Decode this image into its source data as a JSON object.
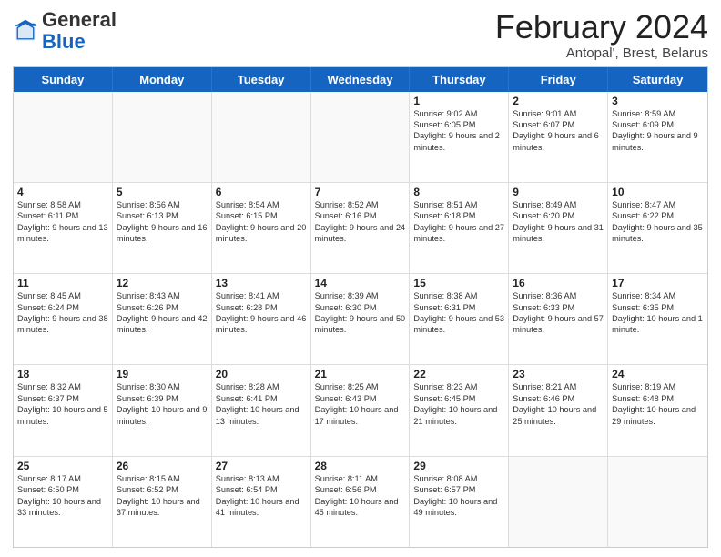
{
  "header": {
    "logo_general": "General",
    "logo_blue": "Blue",
    "month_title": "February 2024",
    "subtitle": "Antopal', Brest, Belarus"
  },
  "days_of_week": [
    "Sunday",
    "Monday",
    "Tuesday",
    "Wednesday",
    "Thursday",
    "Friday",
    "Saturday"
  ],
  "weeks": [
    [
      {
        "day": "",
        "content": ""
      },
      {
        "day": "",
        "content": ""
      },
      {
        "day": "",
        "content": ""
      },
      {
        "day": "",
        "content": ""
      },
      {
        "day": "1",
        "content": "Sunrise: 9:02 AM\nSunset: 6:05 PM\nDaylight: 9 hours\nand 2 minutes."
      },
      {
        "day": "2",
        "content": "Sunrise: 9:01 AM\nSunset: 6:07 PM\nDaylight: 9 hours\nand 6 minutes."
      },
      {
        "day": "3",
        "content": "Sunrise: 8:59 AM\nSunset: 6:09 PM\nDaylight: 9 hours\nand 9 minutes."
      }
    ],
    [
      {
        "day": "4",
        "content": "Sunrise: 8:58 AM\nSunset: 6:11 PM\nDaylight: 9 hours\nand 13 minutes."
      },
      {
        "day": "5",
        "content": "Sunrise: 8:56 AM\nSunset: 6:13 PM\nDaylight: 9 hours\nand 16 minutes."
      },
      {
        "day": "6",
        "content": "Sunrise: 8:54 AM\nSunset: 6:15 PM\nDaylight: 9 hours\nand 20 minutes."
      },
      {
        "day": "7",
        "content": "Sunrise: 8:52 AM\nSunset: 6:16 PM\nDaylight: 9 hours\nand 24 minutes."
      },
      {
        "day": "8",
        "content": "Sunrise: 8:51 AM\nSunset: 6:18 PM\nDaylight: 9 hours\nand 27 minutes."
      },
      {
        "day": "9",
        "content": "Sunrise: 8:49 AM\nSunset: 6:20 PM\nDaylight: 9 hours\nand 31 minutes."
      },
      {
        "day": "10",
        "content": "Sunrise: 8:47 AM\nSunset: 6:22 PM\nDaylight: 9 hours\nand 35 minutes."
      }
    ],
    [
      {
        "day": "11",
        "content": "Sunrise: 8:45 AM\nSunset: 6:24 PM\nDaylight: 9 hours\nand 38 minutes."
      },
      {
        "day": "12",
        "content": "Sunrise: 8:43 AM\nSunset: 6:26 PM\nDaylight: 9 hours\nand 42 minutes."
      },
      {
        "day": "13",
        "content": "Sunrise: 8:41 AM\nSunset: 6:28 PM\nDaylight: 9 hours\nand 46 minutes."
      },
      {
        "day": "14",
        "content": "Sunrise: 8:39 AM\nSunset: 6:30 PM\nDaylight: 9 hours\nand 50 minutes."
      },
      {
        "day": "15",
        "content": "Sunrise: 8:38 AM\nSunset: 6:31 PM\nDaylight: 9 hours\nand 53 minutes."
      },
      {
        "day": "16",
        "content": "Sunrise: 8:36 AM\nSunset: 6:33 PM\nDaylight: 9 hours\nand 57 minutes."
      },
      {
        "day": "17",
        "content": "Sunrise: 8:34 AM\nSunset: 6:35 PM\nDaylight: 10 hours\nand 1 minute."
      }
    ],
    [
      {
        "day": "18",
        "content": "Sunrise: 8:32 AM\nSunset: 6:37 PM\nDaylight: 10 hours\nand 5 minutes."
      },
      {
        "day": "19",
        "content": "Sunrise: 8:30 AM\nSunset: 6:39 PM\nDaylight: 10 hours\nand 9 minutes."
      },
      {
        "day": "20",
        "content": "Sunrise: 8:28 AM\nSunset: 6:41 PM\nDaylight: 10 hours\nand 13 minutes."
      },
      {
        "day": "21",
        "content": "Sunrise: 8:25 AM\nSunset: 6:43 PM\nDaylight: 10 hours\nand 17 minutes."
      },
      {
        "day": "22",
        "content": "Sunrise: 8:23 AM\nSunset: 6:45 PM\nDaylight: 10 hours\nand 21 minutes."
      },
      {
        "day": "23",
        "content": "Sunrise: 8:21 AM\nSunset: 6:46 PM\nDaylight: 10 hours\nand 25 minutes."
      },
      {
        "day": "24",
        "content": "Sunrise: 8:19 AM\nSunset: 6:48 PM\nDaylight: 10 hours\nand 29 minutes."
      }
    ],
    [
      {
        "day": "25",
        "content": "Sunrise: 8:17 AM\nSunset: 6:50 PM\nDaylight: 10 hours\nand 33 minutes."
      },
      {
        "day": "26",
        "content": "Sunrise: 8:15 AM\nSunset: 6:52 PM\nDaylight: 10 hours\nand 37 minutes."
      },
      {
        "day": "27",
        "content": "Sunrise: 8:13 AM\nSunset: 6:54 PM\nDaylight: 10 hours\nand 41 minutes."
      },
      {
        "day": "28",
        "content": "Sunrise: 8:11 AM\nSunset: 6:56 PM\nDaylight: 10 hours\nand 45 minutes."
      },
      {
        "day": "29",
        "content": "Sunrise: 8:08 AM\nSunset: 6:57 PM\nDaylight: 10 hours\nand 49 minutes."
      },
      {
        "day": "",
        "content": ""
      },
      {
        "day": "",
        "content": ""
      }
    ]
  ]
}
